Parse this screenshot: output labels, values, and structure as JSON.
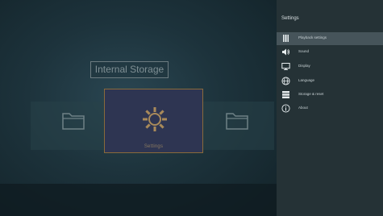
{
  "main": {
    "storage_title": "Internal Storage",
    "tiles": [
      {
        "label": "",
        "icon": "folder-icon"
      },
      {
        "label": "Settings",
        "icon": "gear-icon"
      },
      {
        "label": "",
        "icon": "folder-icon"
      }
    ]
  },
  "panel": {
    "title": "Settings",
    "items": [
      {
        "label": "Playback settings",
        "icon": "playback-icon"
      },
      {
        "label": "Sound",
        "icon": "speaker-icon"
      },
      {
        "label": "Display",
        "icon": "monitor-icon"
      },
      {
        "label": "Language",
        "icon": "globe-icon"
      },
      {
        "label": "Storage & reset",
        "icon": "storage-icon"
      },
      {
        "label": "About",
        "icon": "info-icon"
      }
    ],
    "selected_index": 0
  },
  "colors": {
    "panel_bg": "#253236",
    "selected_bg": "#46545a",
    "highlight_tile_bg": "#2e3552",
    "highlight_tile_border": "#8a6a3a"
  }
}
